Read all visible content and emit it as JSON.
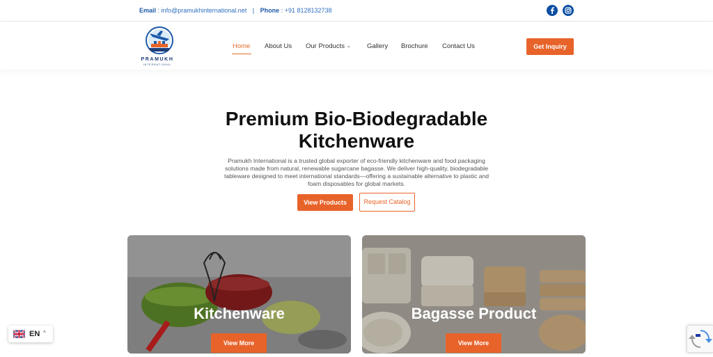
{
  "topbar": {
    "email_label": "Email",
    "email_sep": ":",
    "email_value": "info@pramukhinternational.net",
    "divider": "|",
    "phone_label": "Phone",
    "phone_sep": ":",
    "phone_value": "+91 8128132738",
    "social": [
      "facebook-icon",
      "instagram-icon"
    ]
  },
  "logo": {
    "name": "PRAMUKH",
    "sub": "INTERNATIONAL"
  },
  "nav": {
    "items": [
      {
        "label": "Home",
        "active": true
      },
      {
        "label": "About Us"
      },
      {
        "label": "Our Products",
        "has_dropdown": true
      },
      {
        "label": "Gallery"
      },
      {
        "label": "Brochure"
      },
      {
        "label": "Contact Us"
      }
    ],
    "cta": "Get Inquiry"
  },
  "hero": {
    "title_line1": "Premium Bio-Biodegradable",
    "title_line2": "Kitchenware",
    "description": "Pramukh International is a trusted global exporter of eco-friendly kitchenware and food packaging solutions made from natural, renewable sugarcane bagasse. We deliver high-quality, biodegradable tableware designed to meet international standards—offering a sustainable alternative to plastic and foam disposables for global markets.",
    "primary_button": "View Products",
    "secondary_button": "Request Catalog"
  },
  "cards": [
    {
      "title": "Kitchenware",
      "button": "View More"
    },
    {
      "title": "Bagasse Product",
      "button": "View More"
    }
  ],
  "language": {
    "code": "EN",
    "caret": "^"
  },
  "colors": {
    "accent": "#e8632a",
    "brand_blue": "#1e5aa8",
    "social_blue": "#0b4ea2"
  }
}
